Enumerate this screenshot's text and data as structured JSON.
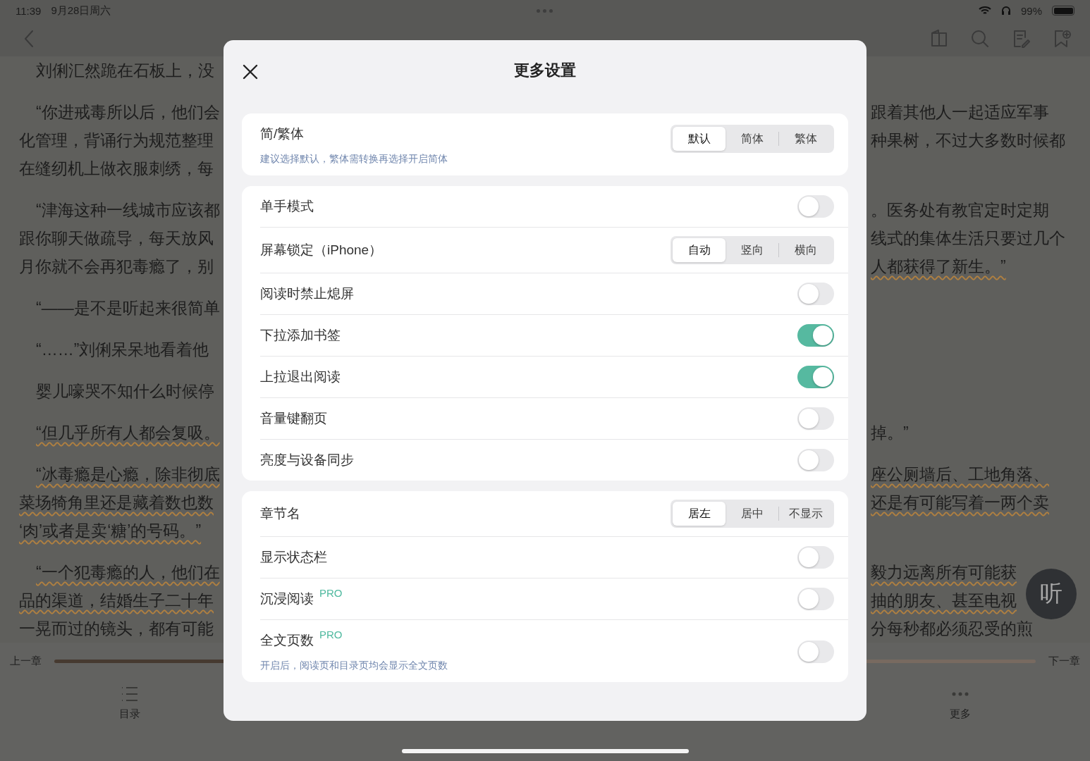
{
  "status_bar": {
    "time": "11:39",
    "date": "9月28日周六",
    "battery": "99%"
  },
  "reader": {
    "lines": [
      {
        "left": "刘俐汇然跪在石板上，没",
        "indent": true,
        "left_underlined": false
      },
      {
        "left": "“你进戒毒所以后，他们会",
        "right": "跟着其他人一起适应军事",
        "indent": true,
        "left_underlined": false,
        "right_underlined": false
      },
      {
        "left": "化管理，背诵行为规范整理",
        "right": "种果树，不过大多数时候都",
        "indent": false,
        "left_underlined": false,
        "right_underlined": false
      },
      {
        "left": "在缝纫机上做衣服刺绣，每",
        "indent": false,
        "left_underlined": false
      },
      {
        "left": "“津海这种一线城市应该都",
        "right": "。医务处有教官定时定期",
        "indent": true,
        "left_underlined": false,
        "right_underlined": false
      },
      {
        "left": "跟你聊天做疏导，每天放风",
        "right": "线式的集体生活只要过几个",
        "indent": false,
        "left_underlined": false,
        "right_underlined": false
      },
      {
        "left": "月你就不会再犯毒瘾了，别",
        "right": "人都获得了新生。”",
        "indent": false,
        "left_underlined": false,
        "right_underlined": true
      },
      {
        "left": "“——是不是听起来很简单",
        "indent": true,
        "left_underlined": false
      },
      {
        "left": "“……”刘俐呆呆地看着他",
        "indent": true,
        "left_underlined": false
      },
      {
        "left": "婴儿嚎哭不知什么时候停",
        "indent": true,
        "left_underlined": false
      },
      {
        "left": "“但几乎所有人都会复吸。",
        "right": "掉。”",
        "indent": true,
        "left_underlined": true,
        "right_underlined": false
      },
      {
        "left": "“冰毒瘾是心瘾，除非彻底",
        "right": "座公厕墙后、工地角落、",
        "indent": true,
        "left_underlined": true,
        "right_underlined": true
      },
      {
        "left": "菜场犄角里还是藏着数也数",
        "right": "还是有可能写着一两个卖",
        "indent": false,
        "left_underlined": true,
        "right_underlined": true
      },
      {
        "left": "‘肉’或者是卖‘糖’的号码。”",
        "indent": false,
        "left_underlined": true
      },
      {
        "left": "“一个犯毒瘾的人，他们在",
        "right": "毅力远离所有可能获",
        "indent": true,
        "left_underlined": true,
        "right_underlined": true
      },
      {
        "left": "品的渠道，结婚生子二十年",
        "right": "抽的朋友、甚至电视",
        "indent": false,
        "left_underlined": true,
        "right_underlined": true
      },
      {
        "left": "一晃而过的镜头，都有可能",
        "right": "分每秒都必须忍受的煎",
        "indent": false,
        "left_underlined": false,
        "right_underlined": false
      }
    ],
    "prev_chapter": "上一章",
    "next_chapter": "下一章",
    "progress": {
      "level": 0.5
    },
    "tabs": [
      {
        "label": "目录",
        "kind": "list"
      },
      {
        "label": "更多",
        "kind": "more"
      }
    ],
    "listen_button": "听"
  },
  "dialog": {
    "title": "更多设置",
    "sections": [
      {
        "rows": [
          {
            "kind": "segmented",
            "label": "简/繁体",
            "note": "建议选择默认，繁体需转换再选择开启简体",
            "options": [
              {
                "label": "默认",
                "selected": true
              },
              {
                "label": "简体",
                "selected": false
              },
              {
                "label": "繁体",
                "selected": false
              }
            ]
          }
        ]
      },
      {
        "rows": [
          {
            "kind": "toggle",
            "label": "单手模式",
            "on": false
          },
          {
            "kind": "segmented",
            "label": "屏幕锁定（iPhone）",
            "options": [
              {
                "label": "自动",
                "selected": true
              },
              {
                "label": "竖向",
                "selected": false
              },
              {
                "label": "横向",
                "selected": false
              }
            ]
          },
          {
            "kind": "toggle",
            "label": "阅读时禁止熄屏",
            "on": false
          },
          {
            "kind": "toggle",
            "label": "下拉添加书签",
            "on": true
          },
          {
            "kind": "toggle",
            "label": "上拉退出阅读",
            "on": true
          },
          {
            "kind": "toggle",
            "label": "音量键翻页",
            "on": false
          },
          {
            "kind": "toggle",
            "label": "亮度与设备同步",
            "on": false
          }
        ]
      },
      {
        "rows": [
          {
            "kind": "segmented",
            "label": "章节名",
            "options": [
              {
                "label": "居左",
                "selected": true
              },
              {
                "label": "居中",
                "selected": false
              },
              {
                "label": "不显示",
                "selected": false
              }
            ]
          },
          {
            "kind": "toggle",
            "label": "显示状态栏",
            "on": false
          },
          {
            "kind": "toggle",
            "label": "沉浸阅读",
            "badge": "PRO",
            "on": false
          },
          {
            "kind": "toggle",
            "label": "全文页数",
            "badge": "PRO",
            "note": "开启后，阅读页和目录页均会显示全文页数",
            "on": false
          }
        ]
      }
    ]
  }
}
